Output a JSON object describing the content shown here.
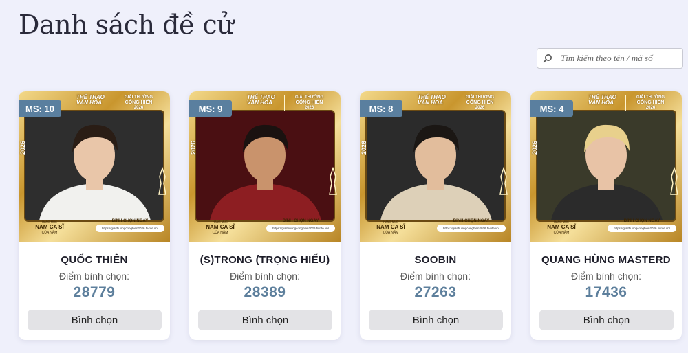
{
  "page": {
    "title": "Danh sách đề cử"
  },
  "search": {
    "placeholder": "Tìm kiếm theo tên / mã số",
    "value": ""
  },
  "poster": {
    "brand_line1": "THỂ THAO",
    "brand_line2": "VĂN HÓA",
    "award_top": "GIẢI THƯỞNG",
    "award_name": "CỐNG HIẾN",
    "award_year": "2026",
    "year_vertical": "2026",
    "category_top": "HẠNG MỤC",
    "category_name": "NAM CA SĨ",
    "category_bottom": "CỦA NĂM",
    "vote_now": "BÌNH CHỌN NGAY",
    "vote_link": "https://giaithuongconghien2026.bvote.vn/"
  },
  "labels": {
    "score_label": "Điểm bình chọn:",
    "vote_button": "Bình chọn"
  },
  "nominees": [
    {
      "ms": "MS: 10",
      "name": "QUỐC THIÊN",
      "score": "28779",
      "photo_bg": "#2e2e2e",
      "suit": "#f1f1ee",
      "hair": "#2a1d15",
      "skin": "#e9c6a9"
    },
    {
      "ms": "MS: 9",
      "name": "(S)TRONG (TRỌNG HIẾU)",
      "score": "28389",
      "photo_bg": "#4a0f12",
      "suit": "#8d1e22",
      "hair": "#1a1210",
      "skin": "#c9936c"
    },
    {
      "ms": "MS: 8",
      "name": "SOOBIN",
      "score": "27263",
      "photo_bg": "#2b2b2b",
      "suit": "#ddd0b8",
      "hair": "#1b1714",
      "skin": "#e2bd9c"
    },
    {
      "ms": "MS: 4",
      "name": "QUANG HÙNG MASTERD",
      "score": "17436",
      "photo_bg": "#3a3a2a",
      "suit": "#2b2b2b",
      "hair": "#e8d08c",
      "skin": "#e8c3a6"
    }
  ]
}
